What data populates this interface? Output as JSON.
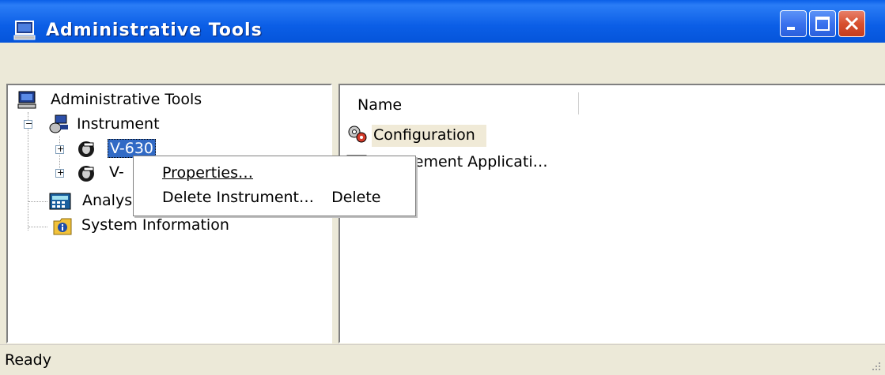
{
  "window": {
    "title": "Administrative Tools"
  },
  "tree": {
    "root_label": "Administrative Tools",
    "instrument_label": "Instrument",
    "v630_label": "V-630",
    "v_second_label": "V-",
    "analysis_label": "Analys",
    "sysinfo_label": "System Information"
  },
  "list": {
    "column_name": "Name",
    "items": [
      {
        "label": "Configuration"
      },
      {
        "label": "M   surement Applicati…"
      }
    ]
  },
  "context_menu": {
    "properties": "Properties…",
    "delete_instrument": "Delete Instrument…",
    "delete_shortcut": "Delete"
  },
  "status": {
    "text": "Ready"
  },
  "colors": {
    "titlebar": "#0453d8",
    "selection": "#316ac5",
    "close_button": "#d8502f"
  }
}
